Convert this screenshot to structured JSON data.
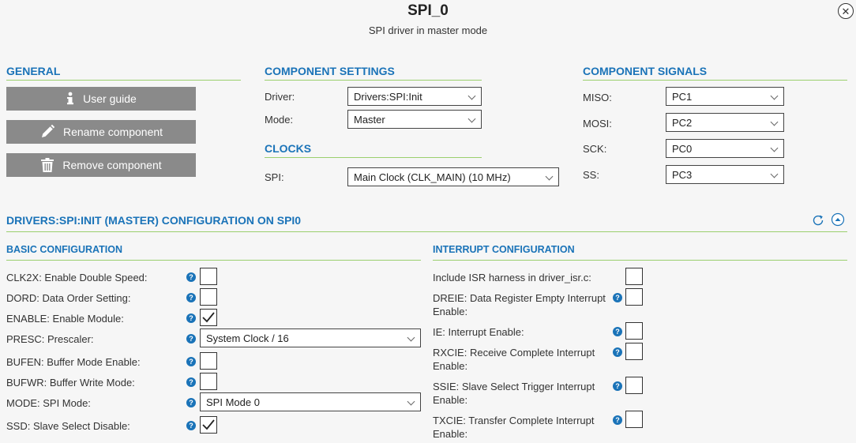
{
  "header": {
    "title": "SPI_0",
    "subtitle": "SPI driver in master mode",
    "close_icon": "close-icon"
  },
  "general": {
    "heading": "GENERAL",
    "buttons": [
      {
        "label": "User guide",
        "icon": "info-icon"
      },
      {
        "label": "Rename component",
        "icon": "pencil-icon"
      },
      {
        "label": "Remove component",
        "icon": "trash-icon"
      }
    ]
  },
  "component_settings": {
    "heading": "COMPONENT SETTINGS",
    "driver_label": "Driver:",
    "driver_value": "Drivers:SPI:Init",
    "mode_label": "Mode:",
    "mode_value": "Master"
  },
  "clocks": {
    "heading": "CLOCKS",
    "spi_label": "SPI:",
    "spi_value": "Main Clock (CLK_MAIN) (10 MHz)"
  },
  "signals": {
    "heading": "COMPONENT SIGNALS",
    "items": [
      {
        "label": "MISO:",
        "value": "PC1"
      },
      {
        "label": "MOSI:",
        "value": "PC2"
      },
      {
        "label": "SCK:",
        "value": "PC0"
      },
      {
        "label": "SS:",
        "value": "PC3"
      }
    ]
  },
  "config": {
    "heading": "DRIVERS:SPI:INIT (MASTER) CONFIGURATION ON SPI0",
    "refresh_icon": "refresh-icon",
    "collapse_icon": "chevron-up-icon",
    "basic": {
      "heading": "BASIC CONFIGURATION",
      "rows": [
        {
          "label": "CLK2X: Enable Double Speed:",
          "checked": false
        },
        {
          "label": "DORD: Data Order Setting:",
          "checked": false
        },
        {
          "label": "ENABLE: Enable Module:",
          "checked": true
        },
        {
          "label": "PRESC: Prescaler:",
          "select": "System Clock / 16"
        },
        {
          "label": "BUFEN: Buffer Mode Enable:",
          "checked": false
        },
        {
          "label": "BUFWR: Buffer Write Mode:",
          "checked": false
        },
        {
          "label": "MODE: SPI Mode:",
          "select": "SPI Mode 0"
        },
        {
          "label": "SSD: Slave Select Disable:",
          "checked": true
        }
      ]
    },
    "interrupt": {
      "heading": "INTERRUPT CONFIGURATION",
      "rows": [
        {
          "label": "Include ISR harness in driver_isr.c:",
          "checked": false
        },
        {
          "label": "DREIE: Data Register Empty Interrupt Enable:",
          "checked": false
        },
        {
          "label": "IE: Interrupt Enable:",
          "checked": false
        },
        {
          "label": "RXCIE: Receive Complete Interrupt Enable:",
          "checked": false
        },
        {
          "label": "SSIE: Slave Select Trigger Interrupt Enable:",
          "checked": false
        },
        {
          "label": "TXCIE: Transfer Complete Interrupt Enable:",
          "checked": false
        }
      ]
    }
  },
  "colors": {
    "accent": "#1a73b8",
    "rule": "#9bcf6e",
    "button_bg": "#8a8a8a",
    "background": "#f6f6f6"
  }
}
